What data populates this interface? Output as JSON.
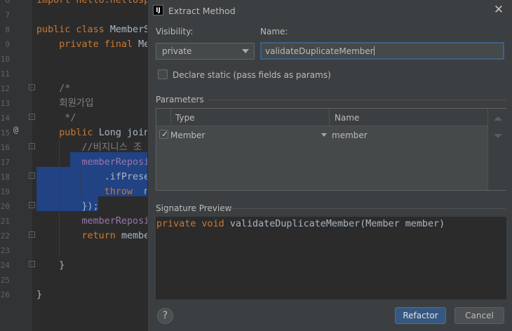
{
  "editor": {
    "line_numbers": [
      "6",
      "7",
      "8",
      "9",
      "10",
      "11",
      "12",
      "13",
      "14",
      "15",
      "16",
      "17",
      "18",
      "19",
      "20",
      "21",
      "22",
      "23",
      "24",
      "25",
      "26"
    ],
    "gutter_marker": "@",
    "lines": [
      {
        "tokens": [
          {
            "t": "import hello.hellosp",
            "c": "kw"
          }
        ]
      },
      {
        "tokens": []
      },
      {
        "tokens": [
          {
            "t": "public class ",
            "c": "kw"
          },
          {
            "t": "MemberS",
            "c": ""
          }
        ]
      },
      {
        "tokens": [
          {
            "t": "    private final ",
            "c": "kw"
          },
          {
            "t": "Me",
            "c": ""
          }
        ]
      },
      {
        "tokens": []
      },
      {
        "tokens": []
      },
      {
        "tokens": [
          {
            "t": "    /*",
            "c": "cm"
          }
        ]
      },
      {
        "tokens": [
          {
            "t": "    회원가입",
            "c": "cm"
          }
        ]
      },
      {
        "tokens": [
          {
            "t": "     */",
            "c": "cm"
          }
        ]
      },
      {
        "tokens": [
          {
            "t": "    public ",
            "c": "kw"
          },
          {
            "t": "Long ",
            "c": ""
          },
          {
            "t": "join",
            "c": ""
          }
        ]
      },
      {
        "tokens": [
          {
            "t": "        //비지니스 조",
            "c": "cm"
          }
        ]
      },
      {
        "tokens": [
          {
            "t": "        ",
            "c": ""
          },
          {
            "t": "memberReposi",
            "c": "fd"
          }
        ]
      },
      {
        "tokens": [
          {
            "t": "            .ifPrese",
            "c": ""
          }
        ]
      },
      {
        "tokens": [
          {
            "t": "            ",
            "c": ""
          },
          {
            "t": "throw ",
            "c": "kw"
          },
          {
            "t": " n",
            "c": ""
          }
        ]
      },
      {
        "tokens": [
          {
            "t": "        });",
            "c": ""
          }
        ]
      },
      {
        "tokens": [
          {
            "t": "        ",
            "c": ""
          },
          {
            "t": "memberReposi",
            "c": "fd"
          }
        ]
      },
      {
        "tokens": [
          {
            "t": "        ",
            "c": ""
          },
          {
            "t": "return ",
            "c": "kw"
          },
          {
            "t": "member",
            "c": ""
          }
        ]
      },
      {
        "tokens": []
      },
      {
        "tokens": [
          {
            "t": "    }",
            "c": ""
          }
        ]
      },
      {
        "tokens": []
      },
      {
        "tokens": [
          {
            "t": "}",
            "c": ""
          }
        ]
      }
    ]
  },
  "dialog": {
    "app_icon_text": "IJ",
    "title": "Extract Method",
    "close_glyph": "✕",
    "visibility_label": "Visibility:",
    "visibility_value": "private",
    "name_label": "Name:",
    "name_value": "validateDuplicateMember",
    "declare_static_label": "Declare static (pass fields as params)",
    "declare_static_checked": false,
    "parameters_label": "Parameters",
    "parameters_columns": [
      "Type",
      "Name"
    ],
    "parameters_rows": [
      {
        "checked": true,
        "type": "Member",
        "name": "member"
      }
    ],
    "signature_label": "Signature Preview",
    "signature_tokens": [
      {
        "t": "private ",
        "c": "kw"
      },
      {
        "t": "void ",
        "c": "kw"
      },
      {
        "t": "validateDuplicateMember(Member member)",
        "c": ""
      }
    ],
    "help_glyph": "?",
    "refactor_label": "Refactor",
    "cancel_label": "Cancel"
  },
  "colors": {
    "accent": "#365880",
    "selection": "#214283",
    "keyword": "#cc7832",
    "comment": "#808080",
    "field": "#9876aa"
  }
}
